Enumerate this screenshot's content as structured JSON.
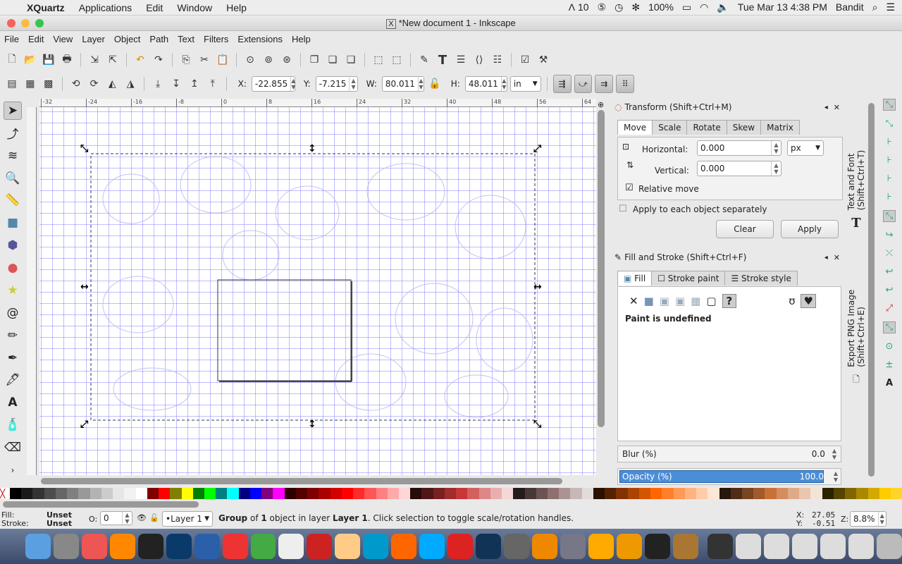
{
  "mac_menubar": {
    "app": "XQuartz",
    "items": [
      "Applications",
      "Edit",
      "Window",
      "Help"
    ],
    "status": {
      "adobe": "10",
      "battery": "100%",
      "datetime": "Tue Mar 13  4:38 PM",
      "user": "Bandit"
    }
  },
  "window": {
    "title": "*New document 1 - Inkscape"
  },
  "menu": [
    "File",
    "Edit",
    "View",
    "Layer",
    "Object",
    "Path",
    "Text",
    "Filters",
    "Extensions",
    "Help"
  ],
  "toolbar2": {
    "x_label": "X:",
    "x": "-22.855",
    "y_label": "Y:",
    "y": "-7.215",
    "w_label": "W:",
    "w": "80.011",
    "h_label": "H:",
    "h": "48.011",
    "unit": "in"
  },
  "ruler": {
    "h_ticks": [
      "-32",
      "-24",
      "-16",
      "-8",
      "0",
      "8",
      "16",
      "24",
      "32",
      "40",
      "48",
      "56",
      "64"
    ]
  },
  "transform": {
    "title": "Transform (Shift+Ctrl+M)",
    "tabs": [
      "Move",
      "Scale",
      "Rotate",
      "Skew",
      "Matrix"
    ],
    "horizontal_label": "Horizontal:",
    "horizontal": "0.000",
    "vertical_label": "Vertical:",
    "vertical": "0.000",
    "unit": "px",
    "relative_move": "Relative move",
    "relative_checked": true,
    "apply_each": "Apply to each object separately",
    "apply_each_checked": false,
    "clear": "Clear",
    "apply": "Apply"
  },
  "fill_stroke": {
    "title": "Fill and Stroke (Shift+Ctrl+F)",
    "tabs": [
      "Fill",
      "Stroke paint",
      "Stroke style"
    ],
    "message": "Paint is undefined",
    "blur_label": "Blur (%)",
    "blur": "0.0",
    "opacity_label": "Opacity (%)",
    "opacity": "100.0",
    "opacity_percent": 100
  },
  "side_tabs": {
    "text_font": "Text and Font (Shift+Ctrl+T)",
    "export": "Export PNG Image (Shift+Ctrl+E)"
  },
  "palette": [
    "#000000",
    "#1a1a1a",
    "#333333",
    "#4d4d4d",
    "#666666",
    "#808080",
    "#999999",
    "#b3b3b3",
    "#cccccc",
    "#e6e6e6",
    "#f2f2f2",
    "#ffffff",
    "#800000",
    "#ff0000",
    "#808000",
    "#ffff00",
    "#008000",
    "#00ff00",
    "#008080",
    "#00ffff",
    "#000080",
    "#0000ff",
    "#800080",
    "#ff00ff",
    "#2b0000",
    "#550000",
    "#800000",
    "#aa0000",
    "#d40000",
    "#ff0000",
    "#ff2a2a",
    "#ff5555",
    "#ff8080",
    "#ffaaaa",
    "#ffd5d5",
    "#280b0b",
    "#501616",
    "#782121",
    "#a02c2c",
    "#c83737",
    "#d35f5f",
    "#de8787",
    "#e9afaf",
    "#f4d7d7",
    "#241c1c",
    "#483737",
    "#6c5353",
    "#916f6f",
    "#ac9393",
    "#c8b7b7",
    "#e3dbdb",
    "#2b1100",
    "#552200",
    "#803300",
    "#aa4400",
    "#d45500",
    "#ff6600",
    "#ff7f2a",
    "#ff9955",
    "#ffb380",
    "#ffccaa",
    "#ffe6d5",
    "#28170b",
    "#502d16",
    "#784421",
    "#a05a2c",
    "#c87137",
    "#d38d5f",
    "#deaa87",
    "#e9c6af",
    "#f4e3d7",
    "#2b2200",
    "#554400",
    "#806600",
    "#aa8800",
    "#d4aa00",
    "#ffcc00",
    "#ffd42a"
  ],
  "status": {
    "fill_label": "Fill:",
    "fill": "Unset",
    "stroke_label": "Stroke:",
    "stroke": "Unset",
    "opacity_label": "O:",
    "opacity": "0",
    "layer": "•Layer 1",
    "msg_b1": "Group",
    "msg_1": " of ",
    "msg_b2": "1",
    "msg_2": " object in layer ",
    "msg_b3": "Layer 1",
    "msg_3": ". Click selection to toggle scale/rotation handles.",
    "x_label": "X:",
    "x": "27.05",
    "y_label": "Y:",
    "y": "-0.51",
    "z_label": "Z:",
    "zoom": "8.8%"
  },
  "dock": [
    "Finder",
    "Launchpad",
    "iTunes",
    "iBooks",
    "Inkscape",
    "Ps",
    "Word",
    "Polarr",
    "Chrome",
    "TextEdit",
    "Spider",
    "Preview",
    "Vectorize",
    "Firefox",
    "Skype",
    "Vivaldi",
    "Steam",
    "Calculator",
    "Scratch",
    "Automator",
    "Photos",
    "Fusion 360",
    "XQuartz",
    "Maps",
    "Screen",
    "Windows",
    "Windows",
    "Windows",
    "Windows",
    "Windows",
    "Trash"
  ]
}
